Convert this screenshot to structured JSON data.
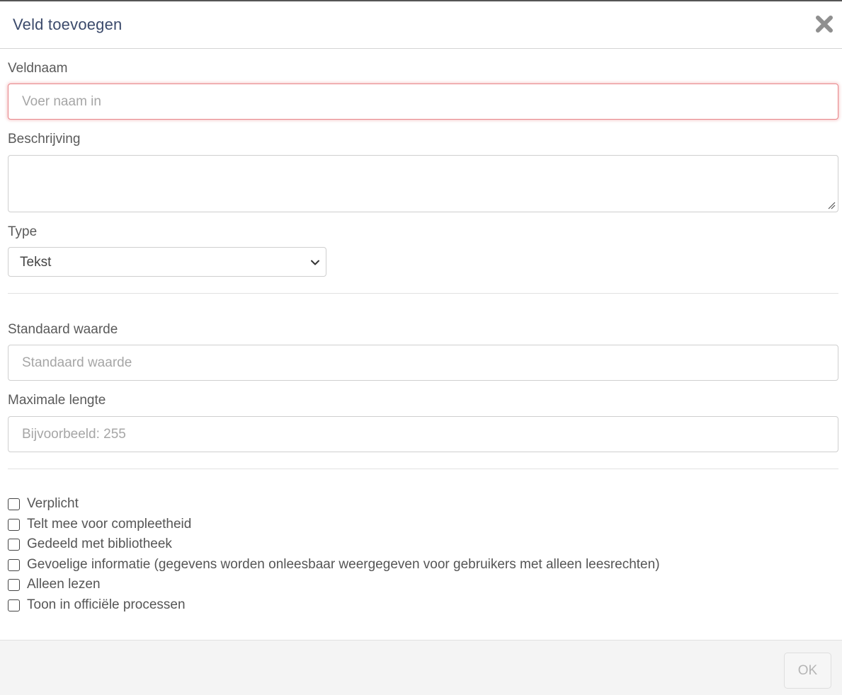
{
  "dialog": {
    "title": "Veld toevoegen"
  },
  "fields": {
    "name": {
      "label": "Veldnaam",
      "placeholder": "Voer naam in",
      "value": ""
    },
    "description": {
      "label": "Beschrijving",
      "value": ""
    },
    "type": {
      "label": "Type",
      "selected": "Tekst"
    },
    "default_value": {
      "label": "Standaard waarde",
      "placeholder": "Standaard waarde",
      "value": ""
    },
    "max_length": {
      "label": "Maximale lengte",
      "placeholder": "Bijvoorbeeld: 255",
      "value": ""
    }
  },
  "options": [
    {
      "label": "Verplicht",
      "checked": false
    },
    {
      "label": "Telt mee voor compleetheid",
      "checked": false
    },
    {
      "label": "Gedeeld met bibliotheek",
      "checked": false
    },
    {
      "label": "Gevoelige informatie (gegevens worden onleesbaar weergegeven voor gebruikers met alleen leesrechten)",
      "checked": false
    },
    {
      "label": "Alleen lezen",
      "checked": false
    },
    {
      "label": "Toon in officiële processen",
      "checked": false
    }
  ],
  "footer": {
    "ok_label": "OK"
  },
  "colors": {
    "title": "#3b4a6b",
    "error_border": "#e8868a",
    "footer_bg": "#f4f4f4"
  },
  "icons": {
    "close": "close-icon",
    "select_arrow": "chevron-down-icon",
    "resize": "resize-handle-icon"
  }
}
